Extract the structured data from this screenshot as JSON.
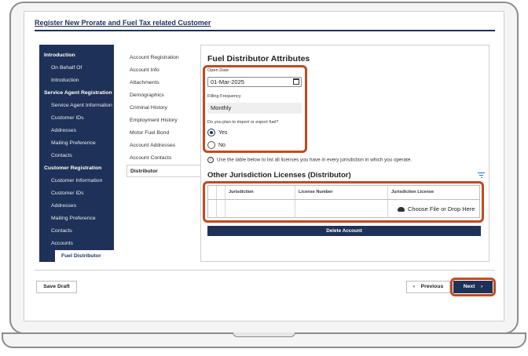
{
  "page_title": "Register New Prorate and Fuel Tax related Customer",
  "sidebar": {
    "items": [
      {
        "label": "Introduction",
        "kind": "section"
      },
      {
        "label": "On Behalf Of",
        "kind": "child"
      },
      {
        "label": "Introduction",
        "kind": "child"
      },
      {
        "label": "Service Agent Registration",
        "kind": "section"
      },
      {
        "label": "Service Agent Information",
        "kind": "child"
      },
      {
        "label": "Customer IDs",
        "kind": "child"
      },
      {
        "label": "Addresses",
        "kind": "child"
      },
      {
        "label": "Mailing Preference",
        "kind": "child"
      },
      {
        "label": "Contacts",
        "kind": "child"
      },
      {
        "label": "Customer Registration",
        "kind": "section"
      },
      {
        "label": "Customer Information",
        "kind": "child"
      },
      {
        "label": "Customer IDs",
        "kind": "child"
      },
      {
        "label": "Addresses",
        "kind": "child"
      },
      {
        "label": "Mailing Preference",
        "kind": "child"
      },
      {
        "label": "Contacts",
        "kind": "child"
      },
      {
        "label": "Accounts",
        "kind": "child"
      },
      {
        "label": "Fuel Distributor",
        "kind": "active"
      }
    ]
  },
  "subnav": {
    "items": [
      "Account Registration",
      "Account Info",
      "Attachments",
      "Demographics",
      "Criminal History",
      "Employment History",
      "Motor Fuel Bond",
      "Account Addresses",
      "Account Contacts",
      "Distributor"
    ],
    "active": "Distributor"
  },
  "form": {
    "title": "Fuel Distributor Attributes",
    "open_date_label": "Open Date",
    "open_date_value": "01-Mar-2025",
    "filing_frequency_label": "Filling Frequency",
    "filing_frequency_value": "Monthly",
    "import_export_question": "Do you plan to import or export fuel?",
    "yes_label": "Yes",
    "no_label": "No",
    "selected": "Yes"
  },
  "licenses": {
    "info_text": "Use the table below to list all licenses you have in every jurisdiction in which you operate.",
    "title": "Other Jurisdiction Licenses (Distributor)",
    "columns": [
      "Jurisdiction",
      "License Number",
      "Jurisdiction License"
    ],
    "upload_text": "Choose File or Drop Here",
    "delete_label": "Delete Account"
  },
  "footer": {
    "save_draft": "Save Draft",
    "previous": "Previous",
    "next": "Next"
  },
  "colors": {
    "navy": "#1e3158",
    "highlight": "#c14a1f"
  }
}
